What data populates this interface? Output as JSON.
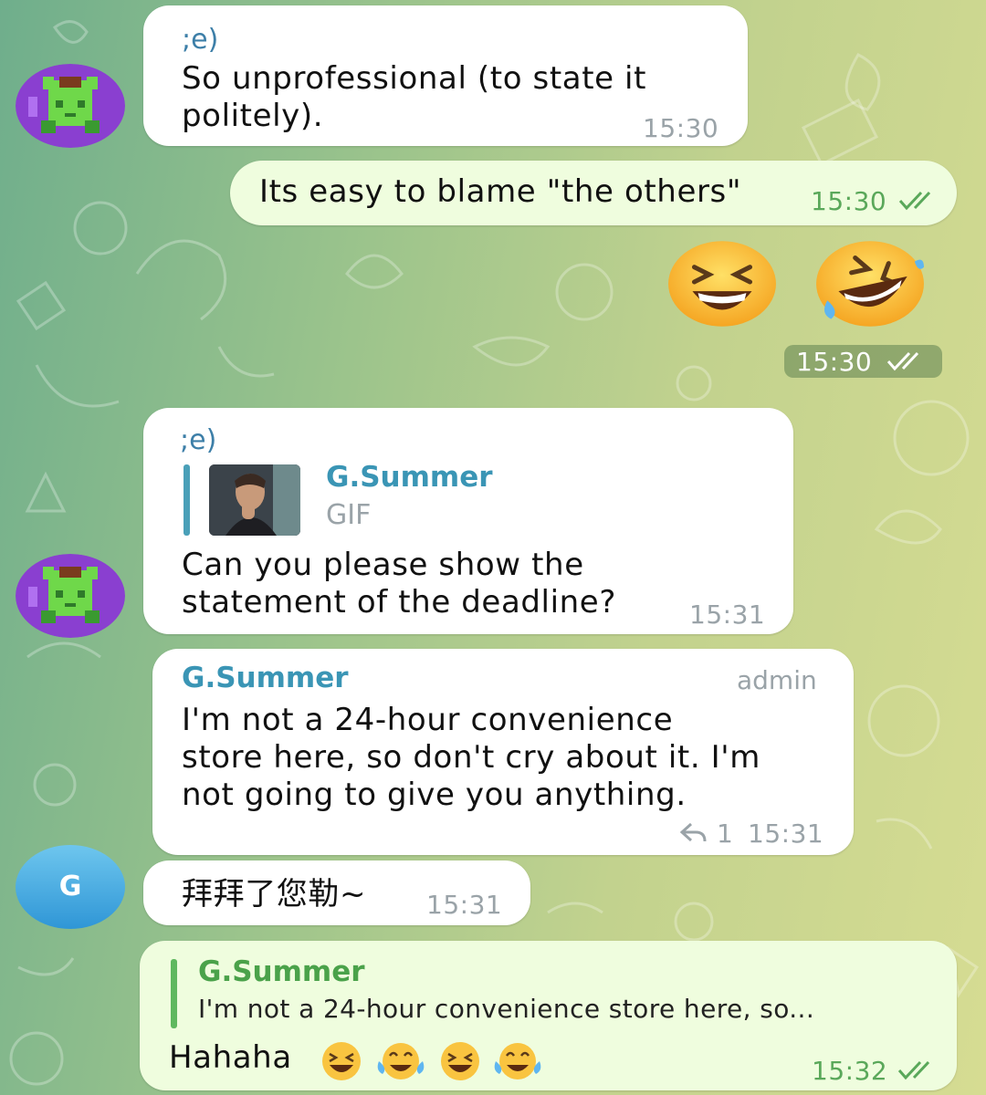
{
  "colors": {
    "accent_blue": "#3a95b5",
    "outgoing_bubble": "#effdde",
    "incoming_bubble": "#ffffff",
    "check_green": "#5aa85a",
    "reply_bar_green": "#5fb85f"
  },
  "messages": {
    "m1": {
      "sender": ";e)",
      "text_line1": "So unprofessional (to state it",
      "text_line2": "politely).",
      "time": "15:30"
    },
    "m2": {
      "text": "Its easy to blame \"the others\"",
      "time": "15:30",
      "status": "read"
    },
    "m3": {
      "emojis": [
        "laughing-face-icon",
        "rolling-on-floor-laughing-icon"
      ],
      "time": "15:30",
      "status": "read"
    },
    "m4": {
      "sender": ";e)",
      "reply": {
        "name": "G.Summer",
        "type": "GIF"
      },
      "text_line1": "Can you please show the",
      "text_line2": "statement of the deadline?",
      "time": "15:31"
    },
    "m5": {
      "sender": "G.Summer",
      "role": "admin",
      "text_line1": "I'm not a 24-hour convenience",
      "text_line2": "store here, so don't cry about it. I'm",
      "text_line3": "not going to give you anything.",
      "replies": "1",
      "time": "15:31"
    },
    "m6": {
      "avatar_letter": "G",
      "text": "拜拜了您勒~",
      "time": "15:31"
    },
    "m7": {
      "reply": {
        "name": "G.Summer",
        "text": "I'm not a 24-hour convenience store here, so..."
      },
      "text": "Hahaha",
      "emojis": [
        "laughing-face-icon",
        "tears-of-joy-icon",
        "laughing-face-icon",
        "tears-of-joy-icon"
      ],
      "time": "15:32",
      "status": "read"
    }
  }
}
